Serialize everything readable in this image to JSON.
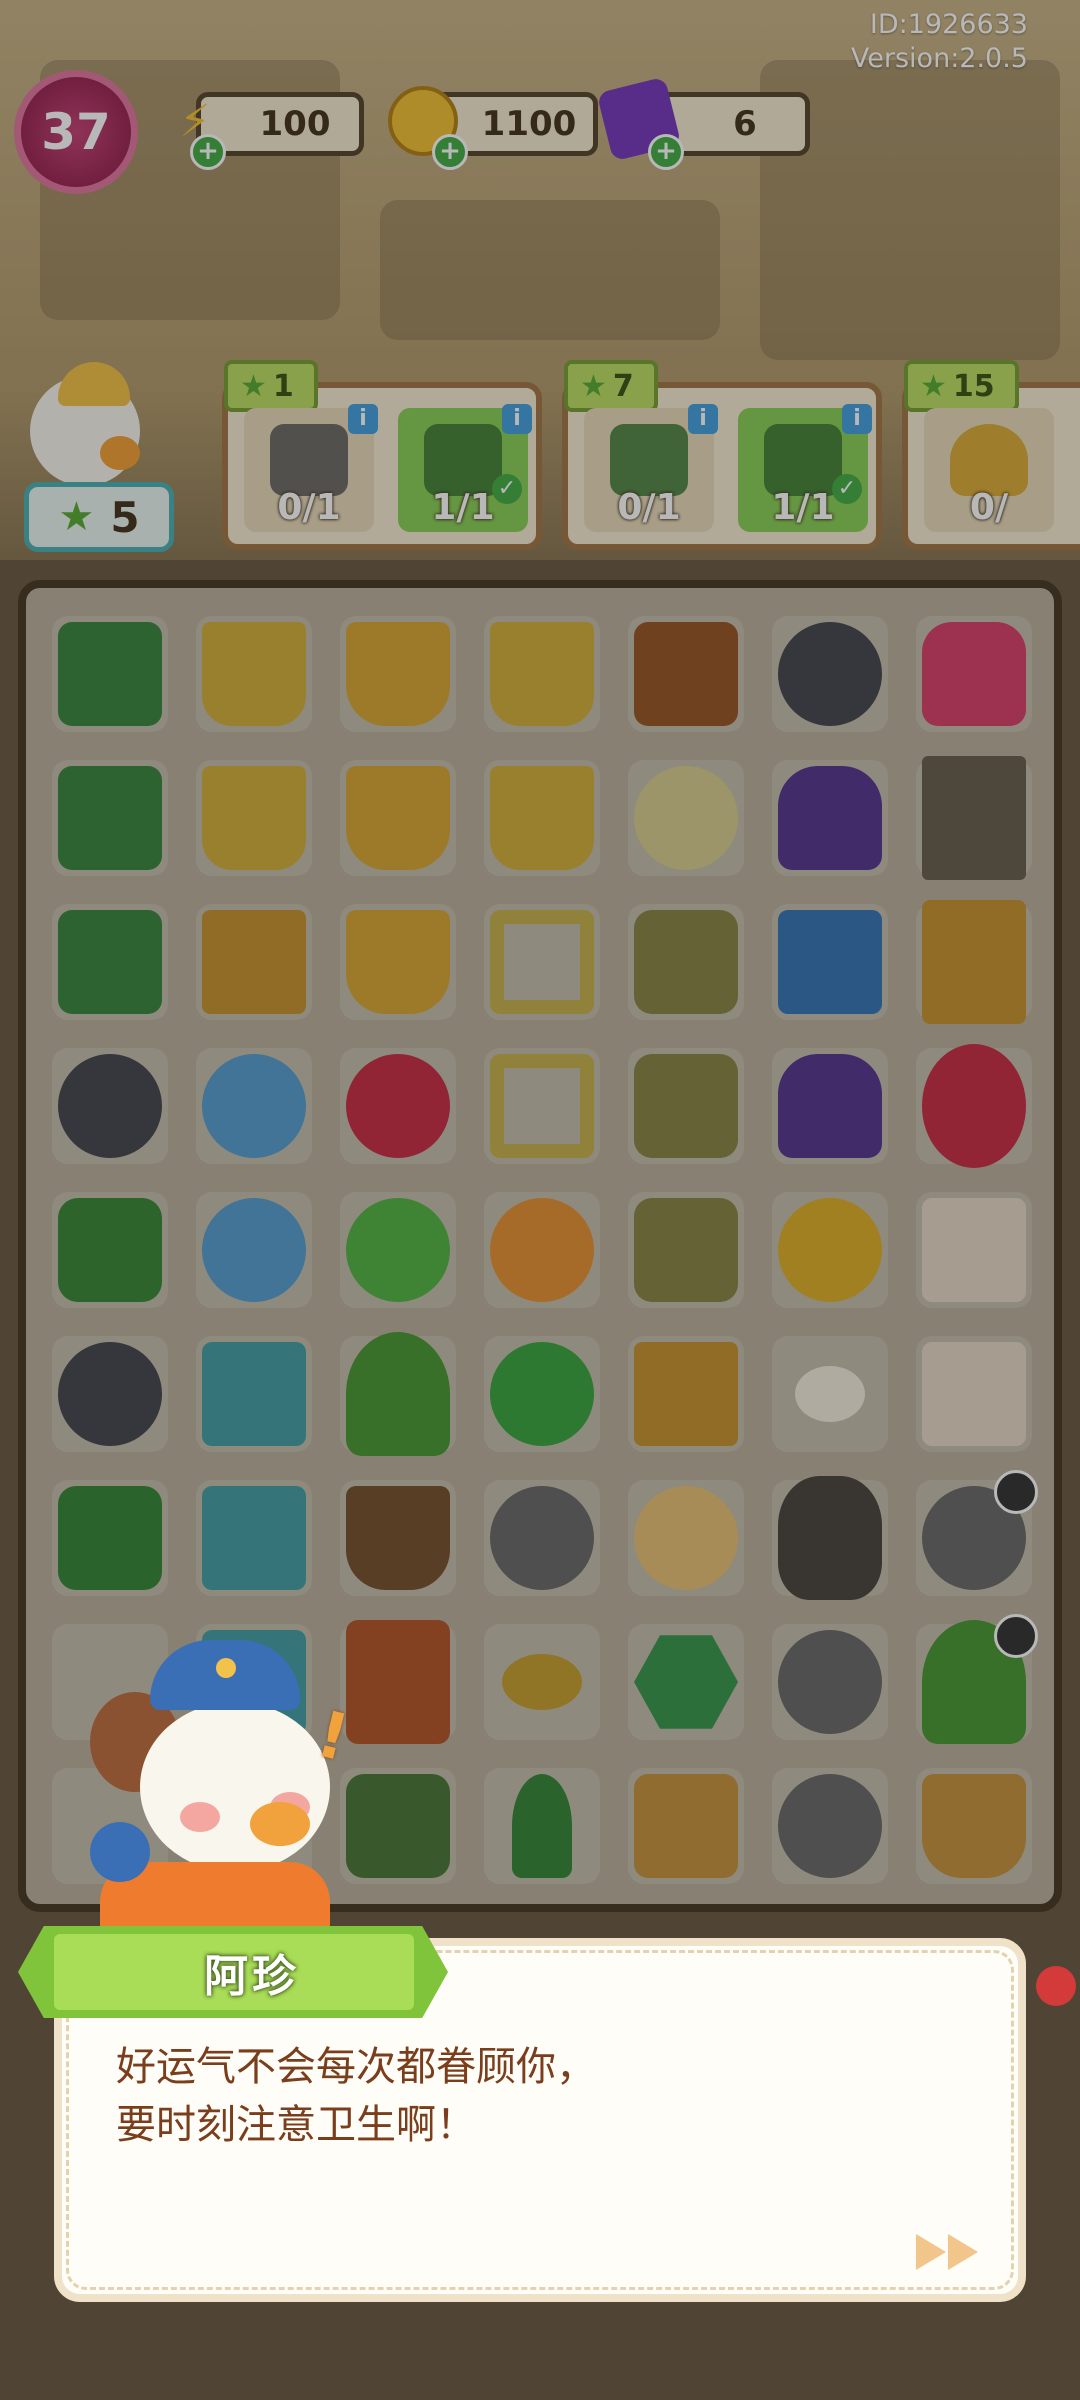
{
  "meta": {
    "id_text": "ID:1926633",
    "version_text": "Version:2.0.5"
  },
  "level": "37",
  "resources": {
    "energy": "100",
    "coins": "1100",
    "gems": "6"
  },
  "player_stars": "5",
  "orders": [
    {
      "stars": "1",
      "slots": [
        {
          "count": "0/1",
          "done": false,
          "item": "pruning-shears"
        },
        {
          "count": "1/1",
          "done": true,
          "item": "work-gloves"
        }
      ]
    },
    {
      "stars": "7",
      "slots": [
        {
          "count": "0/1",
          "done": false,
          "item": "power-drill"
        },
        {
          "count": "1/1",
          "done": true,
          "item": "work-gloves"
        }
      ]
    },
    {
      "stars": "15",
      "slots": [
        {
          "count": "0/",
          "done": false,
          "item": "trophy"
        }
      ]
    }
  ],
  "board_items": [
    "toolbox",
    "shopping-cart-duck",
    "plant-bucket",
    "dumbbell-cart",
    "wallet",
    "dumbbell-bench",
    "backpack",
    "toolbox-open",
    "shopping-cart",
    "bucket",
    "dumbbell-basket",
    "yarn-ball",
    "purple-device",
    "locker",
    "toolbox-closed",
    "cardboard-box",
    "dirt-bucket",
    "frame",
    "sack-stack",
    "circuit-board",
    "cabinet-plant",
    "clamp",
    "robot-vacuum",
    "snail-cat",
    "frame-small",
    "sack",
    "purple-device",
    "wheelbarrow-tools",
    "drill",
    "robot-vacuum-2",
    "energy-bolt-green",
    "energy-bolt-orange",
    "sack-small",
    "coin-stack",
    "tool-basket",
    "wrench",
    "puzzle-piece",
    "potted-tree",
    "plus-five-badge",
    "box-open",
    "mouse",
    "first-aid-box",
    "pliers",
    "puzzle-pile",
    "sprout-pot",
    "shell",
    "hamster",
    "trash-bag",
    "shell",
    "empty",
    "puzzle-piece",
    "cooler",
    "bread-loaf",
    "hex-token",
    "shell",
    "potted-tree",
    "empty",
    "empty",
    "gloves",
    "hose",
    "hamster-pair",
    "shell",
    "wicker-basket"
  ],
  "dialog": {
    "speaker": "阿珍",
    "line1": "好运气不会每次都眷顾你，",
    "line2": "要时刻注意卫生啊！"
  }
}
